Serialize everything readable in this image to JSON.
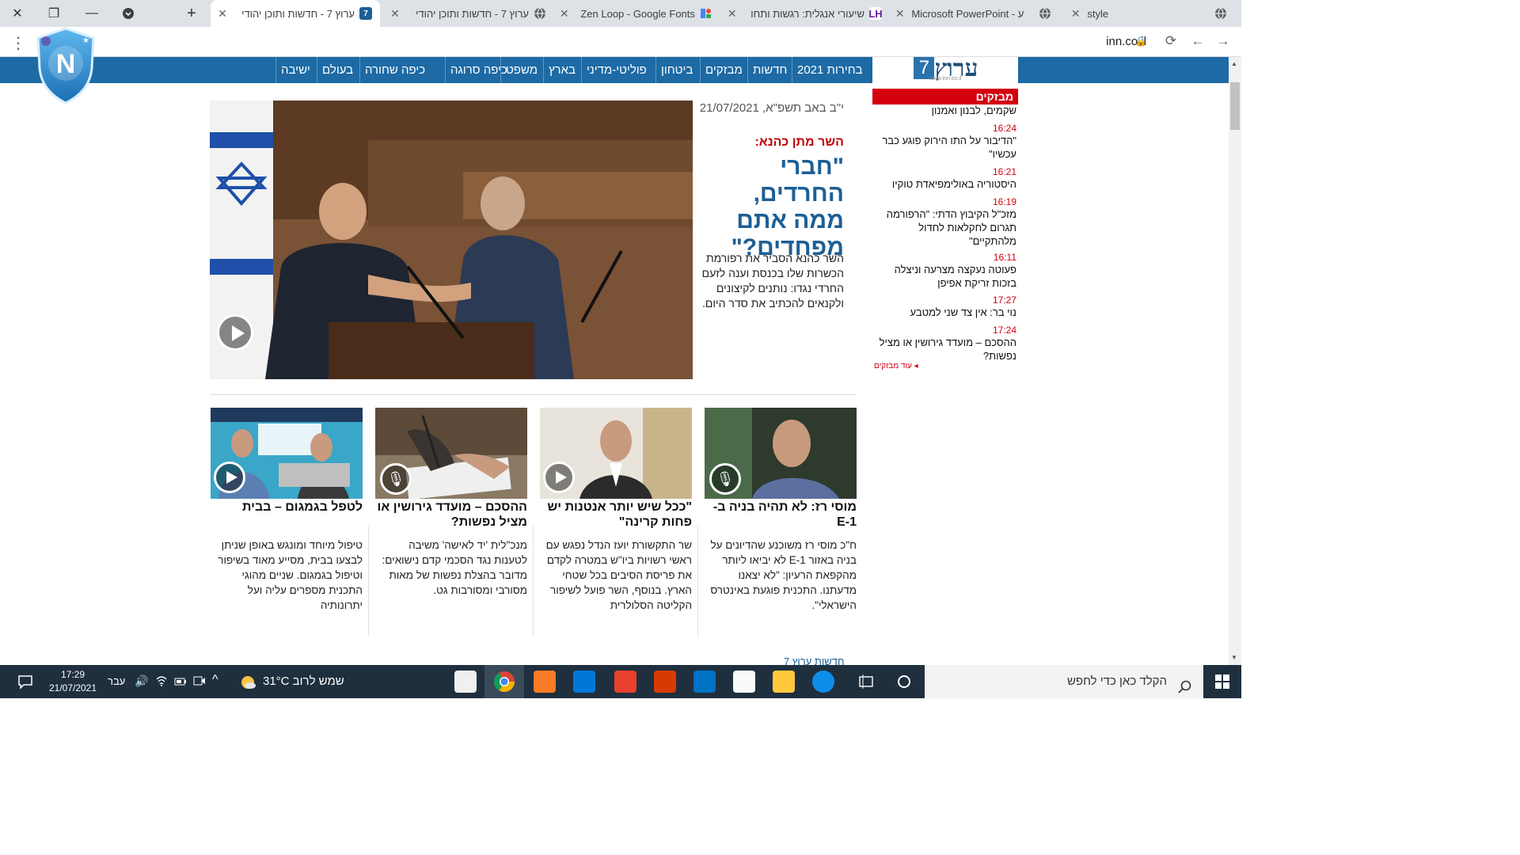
{
  "browser": {
    "tabs": [
      {
        "title": "style",
        "icon": "globe-icon"
      },
      {
        "title": "Microsoft PowerPoint - ע",
        "icon": "globe-icon"
      },
      {
        "title": "שיעורי אנגלית: רגשות ותחו",
        "icon": "lh-icon"
      },
      {
        "title": "Zen Loop - Google Fonts",
        "icon": "google-fonts-icon"
      },
      {
        "title": "ערוץ 7 - חדשות ותוכן יהודי",
        "icon": "globe-icon"
      },
      {
        "title": "ערוץ 7 - חדשות ותוכן יהודי",
        "icon": "arutz7-icon",
        "active": true
      }
    ],
    "url": "inn.co.il"
  },
  "site": {
    "logo_text": "ערוץ",
    "logo_number": "7",
    "logo_sub": "www.inn.co.il",
    "nav": [
      "בחירות 2021",
      "חדשות",
      "מבזקים",
      "ביטחון",
      "פוליטי-מדיני",
      "בארץ",
      "משפט",
      "כיפה סרוגה",
      "כיפה שחורה",
      "בעולם",
      "ישיבה"
    ]
  },
  "breaking": {
    "header": "מבזקים",
    "items": [
      {
        "time": "",
        "text": "שקמים, לבנון ואמנון"
      },
      {
        "time": "16:24",
        "text": "\"הדיבור על התו הירוק פוגע כבר עכשיו\""
      },
      {
        "time": "16:21",
        "text": "היסטוריה באולימפיאדת טוקיו"
      },
      {
        "time": "16:19",
        "text": "מזכ\"ל הקיבוץ הדתי: \"הרפורמה תגרום לחקלאות לחדול מלהתקיים\""
      },
      {
        "time": "16:11",
        "text": "פעוטה נעקצה מצרעה וניצלה בזכות זריקת אפיפן"
      },
      {
        "time": "17:27",
        "text": "נוי בר: אין צד שני למטבע"
      },
      {
        "time": "17:24",
        "text": "ההסכם – מועדד גירושין או מציל נפשות?"
      }
    ],
    "more": "עוד מבזקים"
  },
  "main_story": {
    "date": "י\"ב באב תשפ\"א, 21/07/2021",
    "kicker": "השר מתן כהנא:",
    "title": "\"חברי החרדים, ממה אתם מפחדים?\"",
    "desc": "השר כהנא הסביר את רפורמת הכשרות שלו בכנסת וענה לזעם החרדי נגדו: נותנים לקיצונים ולקנאים להכתיב את סדר היום."
  },
  "cards": [
    {
      "title": "מוסי רז: לא תהיה בניה ב-E-1",
      "desc": "ח\"כ מוסי רז משוכנע שהדיונים על בניה באזור E-1 לא יביאו ליותר מהקפאת הרעיון: \"לא יצאנו מדעתנו. התכנית פוגעת באינטרס הישראלי\".",
      "media": "mic"
    },
    {
      "title": "\"ככל שיש יותר אנטנות יש פחות קרינה\"",
      "desc": "שר התקשורת יועז הנדל נפגש עם ראשי רשויות ביו\"ש במטרה לקדם את פריסת הסיבים בכל שטחי הארץ. בנוסף, השר פועל לשיפור הקליטה הסלולרית",
      "media": "play"
    },
    {
      "title": "ההסכם – מועדד גירושין או מציל נפשות?",
      "desc": "מנכ\"לית 'יד לאישה' משיבה לטענות נגד הסכמי קדם נישואים: מדובר בהצלת נפשות של מאות מסורבי ומסורבות גט.",
      "media": "mic"
    },
    {
      "title": "לטפל בגמגום – בבית",
      "desc": "טיפול מיוחד ומונגש באופן שניתן לבצעו בבית, מסייע מאוד בשיפור וטיפול בגמגום. שניים מהוגי התכנית מספרים עליה ועל יתרונותיה",
      "media": "play"
    }
  ],
  "bottom_link": "חדשות ערוץ 7",
  "taskbar": {
    "search_placeholder": "הקלד כאן כדי לחפש",
    "time": "17:29",
    "date": "21/07/2021",
    "lang": "עבר",
    "weather": "שמש לרוב  31°C"
  },
  "colors": {
    "nav_blue": "#1d6aa5",
    "breaking_red": "#d4000e",
    "title_blue": "#1d5f95"
  }
}
